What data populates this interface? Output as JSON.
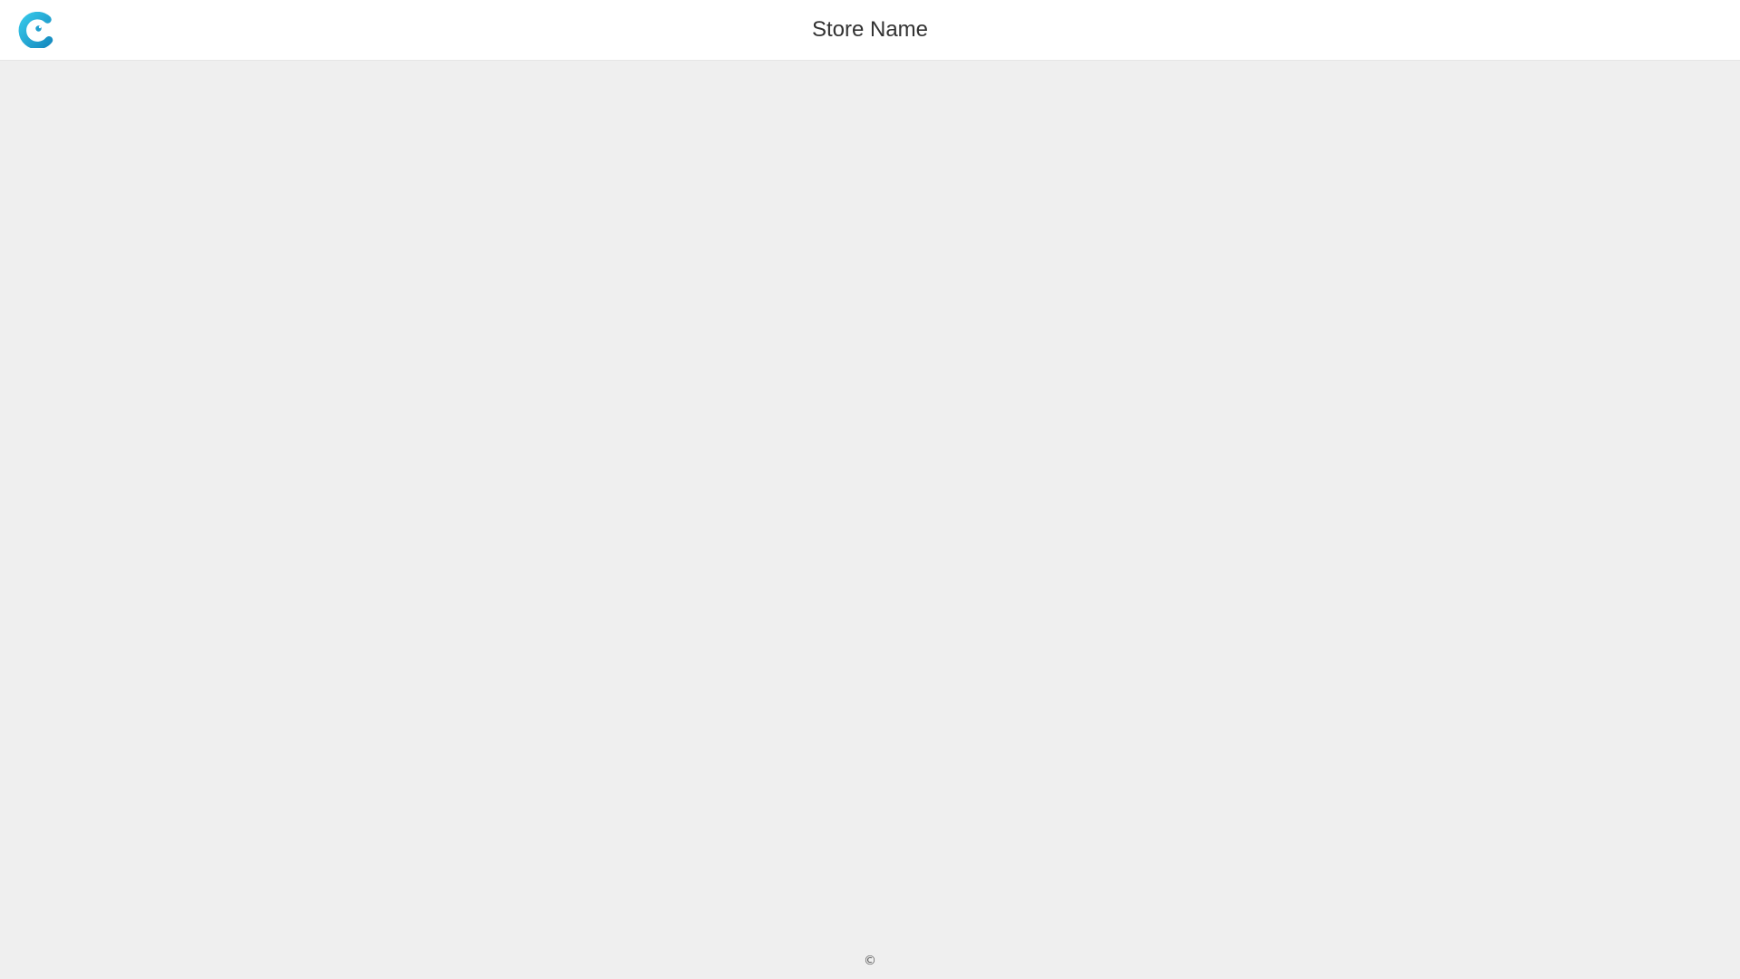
{
  "header": {
    "store_name": "Store Name",
    "logo_icon": "store-logo-icon",
    "logo_colors": {
      "outer": "#1f9fcf",
      "inner": "#3cc6e6",
      "dot": "#1777a8"
    }
  },
  "footer": {
    "copyright": "©"
  },
  "colors": {
    "header_bg": "#ffffff",
    "page_bg": "#efefef",
    "text": "#333333"
  }
}
